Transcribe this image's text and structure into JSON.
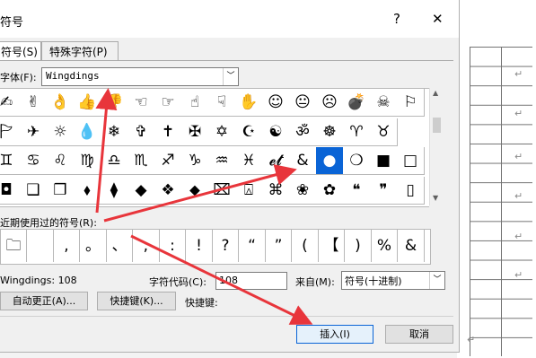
{
  "dialog": {
    "title": "符号",
    "help_glyph": "?",
    "close_glyph": "✕"
  },
  "tabs": [
    {
      "label": "符号(S)"
    },
    {
      "label": "特殊字符(P)"
    }
  ],
  "font": {
    "label": "字体(F):",
    "value": "Wingdings"
  },
  "grid": {
    "rows": [
      [
        "✍",
        "✌",
        "👌",
        "👍",
        "👎",
        "☜",
        "☞",
        "☝",
        "☟",
        "✋",
        "☺",
        "😐",
        "☹",
        "💣",
        "☠",
        "⚐"
      ],
      [
        "🏱",
        "✈",
        "☼",
        "💧",
        "❄",
        "✞",
        "✝",
        "✠",
        "✡",
        "☪",
        "☯",
        "ॐ",
        "☸",
        "♈",
        "♉"
      ],
      [
        "♊",
        "♋",
        "♌",
        "♍",
        "♎",
        "♏",
        "♐",
        "♑",
        "♒",
        "♓",
        "𝓮𝓽",
        "&",
        "●",
        "❍",
        "■",
        "□"
      ],
      [
        "◘",
        "❑",
        "❒",
        "⬧",
        "⧫",
        "◆",
        "❖",
        "⬥",
        "⌧",
        "⍓",
        "⌘",
        "❀",
        "✿",
        "❝",
        "❞",
        "▯"
      ]
    ],
    "selected": {
      "row": 2,
      "col": 12
    }
  },
  "recent": {
    "label": "近期使用过的符号(R):",
    "symbols": [
      "🗀",
      "",
      ",",
      "。",
      "、",
      ";",
      ":",
      "!",
      "?",
      "“",
      "”",
      "(",
      "【",
      ")",
      "%",
      "&"
    ]
  },
  "info": {
    "font_name_text": "Wingdings: 108",
    "code_label": "字符代码(C):",
    "code_value": "108",
    "from_label": "来自(M):",
    "from_value": "符号(十进制)"
  },
  "buttons": {
    "autocorrect": "自动更正(A)...",
    "shortcut": "快捷键(K)...",
    "shortcut_label": "快捷键:",
    "insert": "插入(I)",
    "cancel": "取消"
  },
  "colors": {
    "accent": "#0a64d6",
    "arrow": "#e8353b"
  }
}
